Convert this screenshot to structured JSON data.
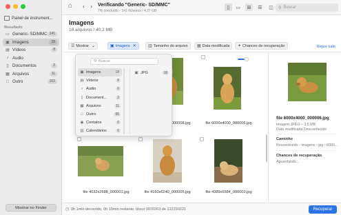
{
  "sidebar": {
    "device_label": "Painel de instrument...",
    "section_label": "Resultado",
    "items": [
      {
        "icon": "drive-icon",
        "glyph": "▭",
        "label": "Generic- SD/MMC",
        "count": "141",
        "active": false
      },
      {
        "icon": "image-icon",
        "glyph": "▣",
        "label": "Imagens",
        "count": "18",
        "active": true
      },
      {
        "icon": "video-icon",
        "glyph": "▤",
        "label": "Vídeos",
        "count": "8",
        "active": false
      },
      {
        "icon": "audio-icon",
        "glyph": "♪",
        "label": "Áudio",
        "count": "",
        "active": false
      },
      {
        "icon": "document-icon",
        "glyph": "▯",
        "label": "Documentos",
        "count": "2",
        "active": false
      },
      {
        "icon": "archive-icon",
        "glyph": "▦",
        "label": "Arquivos",
        "count": "11",
        "active": false
      },
      {
        "icon": "other-icon",
        "glyph": "□",
        "label": "Outro",
        "count": "102",
        "active": false
      }
    ],
    "finder_button": "Mostrar no Finder"
  },
  "titlebar": {
    "title": "Verificando \"Generic- SD/MMC\"",
    "subtitle": "7% concluído - 141 ficheiros / 4,27 GB",
    "search_placeholder": "Buscar"
  },
  "header": {
    "title": "Imagens",
    "subtitle": "18 arquivos / 40,2 MB"
  },
  "filters": {
    "show": "Mostrar",
    "images": "Imagens",
    "size": "Tamanho do arquivo",
    "modified": "Data modificada",
    "chances": "Chances de recuperação",
    "reset": "Repor tudo"
  },
  "dropdown": {
    "search_placeholder": "Buscar",
    "categories": [
      {
        "icon": "image-icon",
        "glyph": "▣",
        "label": "Imagens",
        "count": "18",
        "selected": true
      },
      {
        "icon": "video-icon",
        "glyph": "▤",
        "label": "Vídeos",
        "count": "8",
        "selected": false
      },
      {
        "icon": "audio-icon",
        "glyph": "♪",
        "label": "Áudio",
        "count": "0",
        "selected": false
      },
      {
        "icon": "document-icon",
        "glyph": "▯",
        "label": "Document...",
        "count": "2",
        "selected": false
      },
      {
        "icon": "archive-icon",
        "glyph": "▦",
        "label": "Arquivos",
        "count": "11",
        "selected": false
      },
      {
        "icon": "other-icon",
        "glyph": "□",
        "label": "Outro",
        "count": "95",
        "selected": false
      },
      {
        "icon": "contacts-icon",
        "glyph": "◉",
        "label": "Contatos",
        "count": "0",
        "selected": false
      },
      {
        "icon": "calendar-icon",
        "glyph": "▥",
        "label": "Calendários",
        "count": "0",
        "selected": false
      }
    ],
    "formats": [
      {
        "icon": "jpg-file-icon",
        "glyph": "▣",
        "label": "JPG",
        "count": "18"
      }
    ]
  },
  "files": [
    {
      "name": "file 4000x6000_000008.jpg"
    },
    {
      "name": "file 6000x4000_000006.jpg"
    },
    {
      "name": "file 4032x2688_000001.jpg"
    },
    {
      "name": "file 4160x6240_000005.jpg"
    },
    {
      "name": "file 4389x6584_000003.jpg"
    }
  ],
  "partial_caption": "jpg",
  "preview": {
    "filename": "file 6000x4000_000006.jpg",
    "type_line": "Imagem JPEG – 3,5 MB",
    "modified_line": "Data modificada  Desconhecido",
    "path_label": "Caminho",
    "path_value": "Reconstruído › Imagens › jpg › 6000...",
    "chances_label": "Chances de recuperação",
    "chances_value": "Aguardando..."
  },
  "status": {
    "text": "0h 1min decorrido, 0h 10min restante, bloco 9070263 de 122150221",
    "recover_button": "Recuperar"
  },
  "colors": {
    "accent": "#2b74e8",
    "close": "#ff5f57",
    "minimize": "#febc2e",
    "zoom": "#28c840"
  }
}
